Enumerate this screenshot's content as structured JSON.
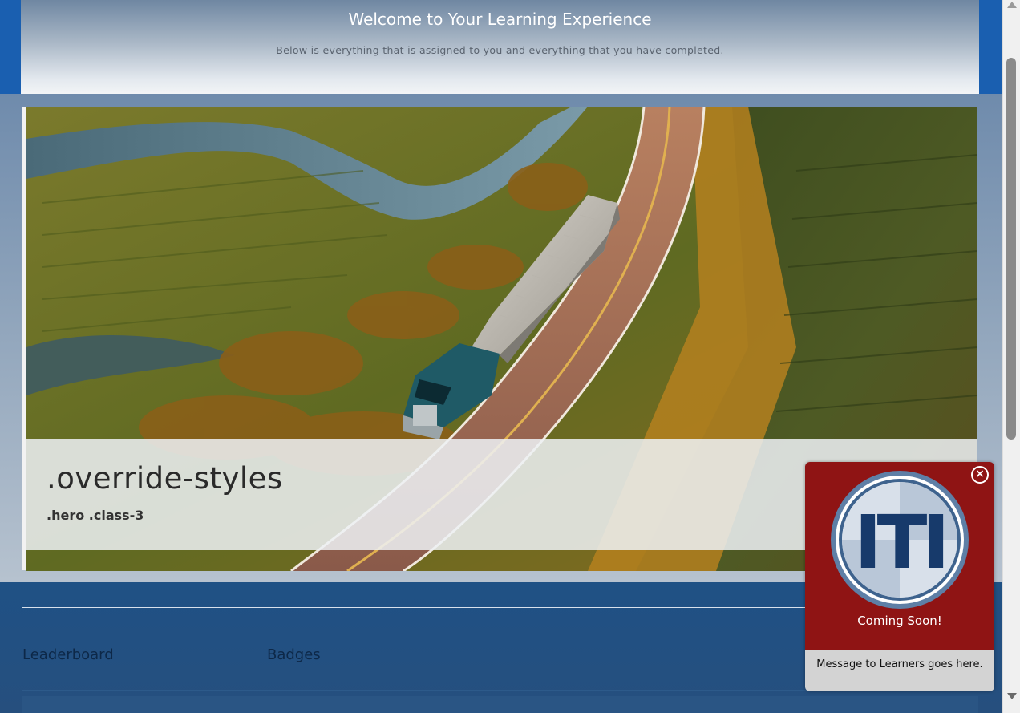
{
  "header": {
    "title": "Welcome to Your Learning Experience",
    "subtitle": "Below is everything that is assigned to you and everything that you have completed."
  },
  "hero": {
    "title": ".override-styles",
    "subtitle": ".hero .class-3"
  },
  "footer": {
    "tabs": [
      "Leaderboard",
      "Badges"
    ]
  },
  "popup": {
    "logo_text": "ITI",
    "heading": "Coming Soon!",
    "message": "Message to Learners goes here.",
    "close_symbol": "×",
    "colors": {
      "header_bg": "#8f1414",
      "footer_bg": "#d3d3d3",
      "logo_navy": "#173a6b"
    }
  }
}
